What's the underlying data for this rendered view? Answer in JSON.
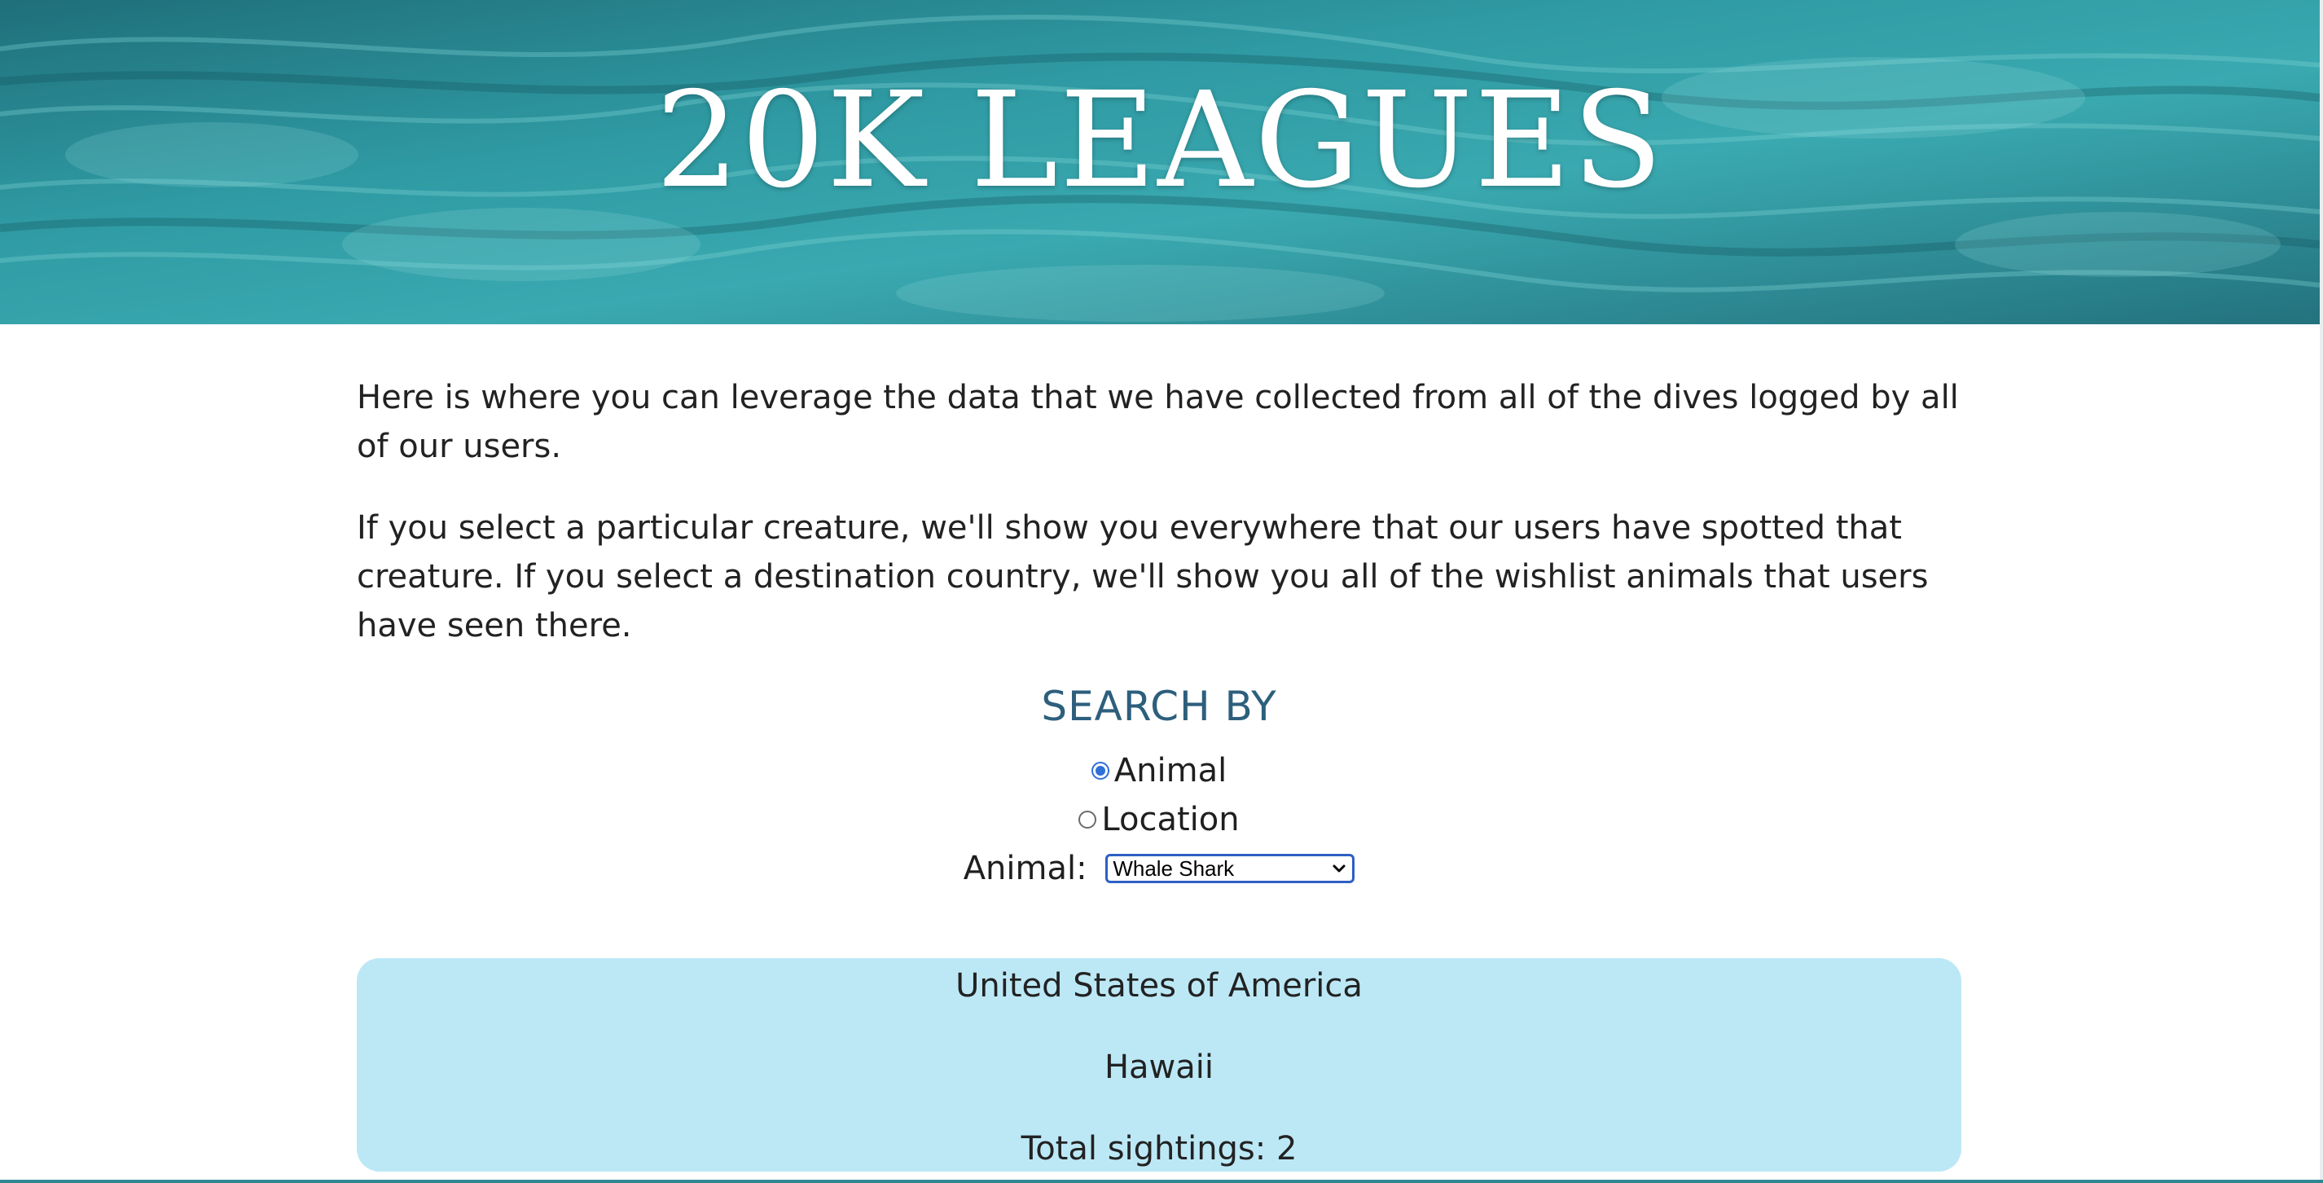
{
  "site": {
    "title": "20K LEAGUES"
  },
  "intro": {
    "paragraph1": "Here is where you can leverage the data that we have collected from all of the dives logged by all of our users.",
    "paragraph2": "If you select a particular creature, we'll show you everywhere that our users have spotted that creature. If you select a destination country, we'll show you all of the wishlist animals that users have seen there."
  },
  "search": {
    "heading": "SEARCH BY",
    "options": [
      {
        "label": "Animal",
        "checked": true
      },
      {
        "label": "Location",
        "checked": false
      }
    ],
    "select_label": "Animal:",
    "select_value": "Whale Shark"
  },
  "results": {
    "country": "United States of America",
    "region": "Hawaii",
    "total": "Total sightings: 2"
  },
  "colors": {
    "heading": "#2d5f7d",
    "results_bg": "#bce8f6",
    "radio_accent": "#2f6fd8",
    "hero_water": "#2b8d96"
  },
  "icons": {
    "select_arrow": "chevron-down-icon"
  }
}
